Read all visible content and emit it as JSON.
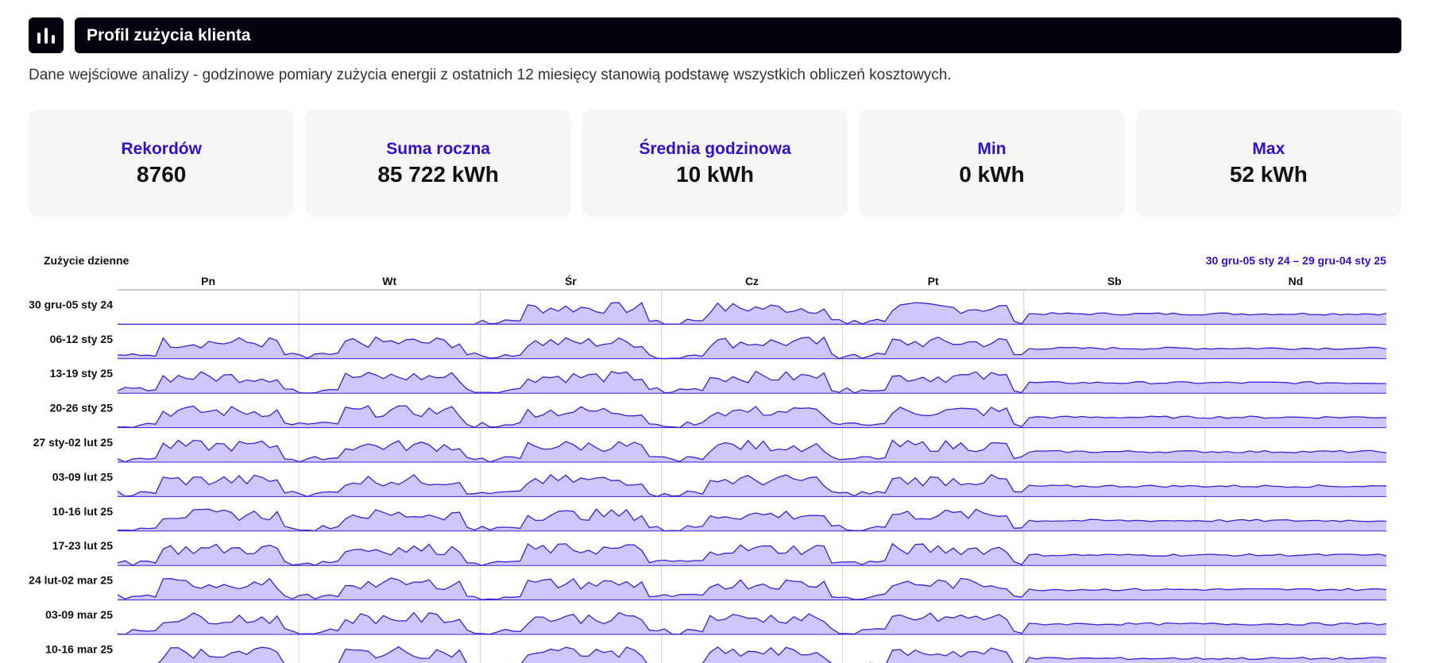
{
  "header": {
    "title": "Profil zużycia klienta",
    "logo_icon": "bar-chart-icon"
  },
  "subtitle": "Dane wejściowe analizy - godzinowe pomiary zużycia energii z ostatnich 12 miesięcy stanowią podstawę wszystkich obliczeń kosztowych.",
  "stats": [
    {
      "label": "Rekordów",
      "value": "8760"
    },
    {
      "label": "Suma roczna",
      "value": "85 722 kWh"
    },
    {
      "label": "Średnia godzinowa",
      "value": "10 kWh"
    },
    {
      "label": "Min",
      "value": "0 kWh"
    },
    {
      "label": "Max",
      "value": "52 kWh"
    }
  ],
  "colors": {
    "accent": "#2d10d6",
    "fill": "#cfc6fb",
    "line": "#3a22d6",
    "dark": "#03020f"
  },
  "chart_data": {
    "type": "area",
    "title": "Zużycie dzienne",
    "range_label": "30 gru-05 sty 24 – 29 gru-04 sty 25",
    "days": [
      "Pn",
      "Wt",
      "Śr",
      "Cz",
      "Pt",
      "Sb",
      "Nd"
    ],
    "weeks": [
      "30 gru-05 sty 24",
      "06-12 sty 25",
      "13-19 sty 25",
      "20-26 sty 25",
      "27 sty-02 lut 25",
      "03-09 lut 25",
      "10-16 lut 25",
      "17-23 lut 25",
      "24 lut-02 mar 25",
      "03-09 mar 25",
      "10-16 mar 25"
    ],
    "ylim": [
      0,
      52
    ],
    "grid": true
  }
}
